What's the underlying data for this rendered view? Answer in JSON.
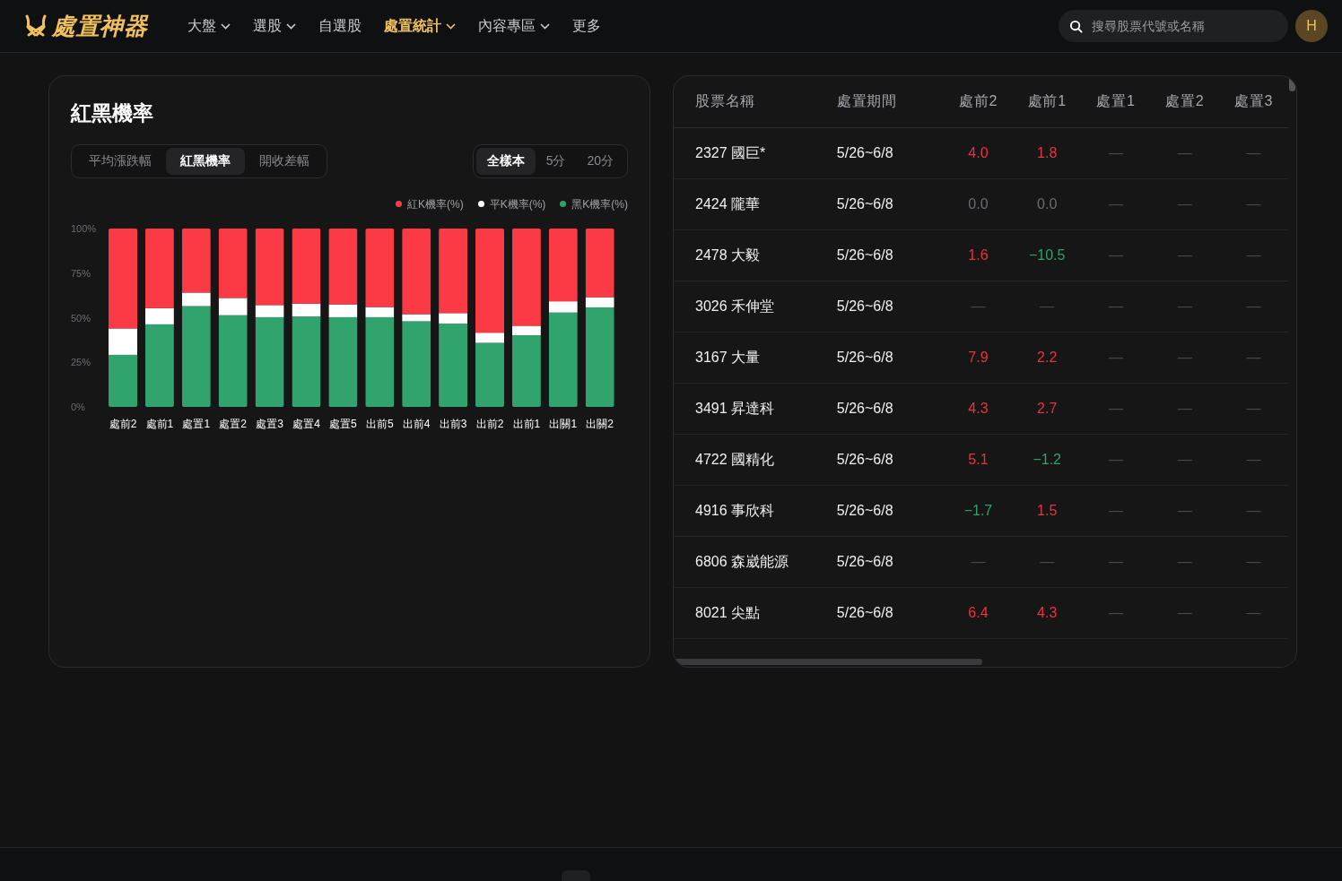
{
  "nav": {
    "logo": "處置神器",
    "items": [
      {
        "label": "大盤",
        "dropdown": true,
        "selected": false
      },
      {
        "label": "選股",
        "dropdown": true,
        "selected": false
      },
      {
        "label": "自選股",
        "dropdown": false,
        "selected": false
      },
      {
        "label": "處置統計",
        "dropdown": true,
        "selected": true
      },
      {
        "label": "內容專區",
        "dropdown": true,
        "selected": false
      },
      {
        "label": "更多",
        "dropdown": false,
        "selected": false
      }
    ],
    "search": {
      "placeholder": "搜尋股票代號或名稱"
    },
    "avatar": "H"
  },
  "chart_card": {
    "title": "紅黑機率",
    "metric_tabs": [
      {
        "label": "平均漲跌幅",
        "selected": false
      },
      {
        "label": "紅黑機率",
        "selected": true
      },
      {
        "label": "開收差幅",
        "selected": false
      }
    ],
    "sample_tabs": [
      {
        "label": "全樣本",
        "selected": true
      },
      {
        "label": "5分",
        "selected": false
      },
      {
        "label": "20分",
        "selected": false
      }
    ],
    "chart_data": {
      "type": "bar",
      "stacked": true,
      "categories": [
        "處前2",
        "處前1",
        "處置1",
        "處置2",
        "處置3",
        "處置4",
        "處置5",
        "出前5",
        "出前4",
        "出前3",
        "出前2",
        "出前1",
        "出關1",
        "出關2"
      ],
      "ylim": [
        0,
        100
      ],
      "yticks": [
        {
          "value": 0,
          "label": "0%"
        },
        {
          "value": 25,
          "label": "25%"
        },
        {
          "value": 50,
          "label": "50%"
        },
        {
          "value": 75,
          "label": "75%"
        },
        {
          "value": 100,
          "label": "100%"
        }
      ],
      "series": [
        {
          "name": "紅K機率(%)",
          "color": "#fc3a45",
          "values": [
            56,
            44.6,
            35.9,
            38.9,
            42.9,
            42.1,
            42.5,
            44,
            48,
            47.4,
            58.4,
            54.5,
            40.8,
            38.5
          ]
        },
        {
          "name": "平K機率(%)",
          "color": "#ffffff",
          "values": [
            14.8,
            9.1,
            7.6,
            9.7,
            6.8,
            7.2,
            7.2,
            5.7,
            4,
            5.9,
            5.7,
            5.3,
            6.3,
            5.7
          ]
        },
        {
          "name": "黑K機率(%)",
          "color": "#31a36d",
          "values": [
            29.2,
            46.3,
            56.5,
            51.4,
            50.3,
            50.7,
            50.3,
            50.3,
            48,
            46.7,
            35.9,
            40.2,
            52.9,
            55.8
          ]
        }
      ]
    }
  },
  "table": {
    "columns": [
      "股票名稱",
      "處置期間",
      "處前2",
      "處前1",
      "處置1",
      "處置2",
      "處置3"
    ],
    "rows": [
      {
        "cells": [
          {
            "text": "2327 國巨*",
            "color": "#f0f0f0"
          },
          {
            "text": "5/26~6/8",
            "color": "#f0f0f0"
          },
          {
            "text": "4.0",
            "color": "#e8333d"
          },
          {
            "text": "1.8",
            "color": "#e8333d"
          },
          {
            "text": "—",
            "color": "#4a4b4f"
          },
          {
            "text": "—",
            "color": "#4a4b4f"
          },
          {
            "text": "—",
            "color": "#4a4b4f"
          }
        ]
      },
      {
        "cells": [
          {
            "text": "2424 隴華",
            "color": "#f0f0f0"
          },
          {
            "text": "5/26~6/8",
            "color": "#f0f0f0"
          },
          {
            "text": "0.0",
            "color": "#6b6c70"
          },
          {
            "text": "0.0",
            "color": "#6b6c70"
          },
          {
            "text": "—",
            "color": "#4a4b4f"
          },
          {
            "text": "—",
            "color": "#4a4b4f"
          },
          {
            "text": "—",
            "color": "#4a4b4f"
          }
        ]
      },
      {
        "cells": [
          {
            "text": "2478 大毅",
            "color": "#f0f0f0"
          },
          {
            "text": "5/26~6/8",
            "color": "#f0f0f0"
          },
          {
            "text": "1.6",
            "color": "#e8333d"
          },
          {
            "text": "−10.5",
            "color": "#2ea36a"
          },
          {
            "text": "—",
            "color": "#4a4b4f"
          },
          {
            "text": "—",
            "color": "#4a4b4f"
          },
          {
            "text": "—",
            "color": "#4a4b4f"
          }
        ]
      },
      {
        "cells": [
          {
            "text": "3026 禾伸堂",
            "color": "#f0f0f0"
          },
          {
            "text": "5/26~6/8",
            "color": "#f0f0f0"
          },
          {
            "text": "—",
            "color": "#4a4b4f"
          },
          {
            "text": "—",
            "color": "#4a4b4f"
          },
          {
            "text": "—",
            "color": "#4a4b4f"
          },
          {
            "text": "—",
            "color": "#4a4b4f"
          },
          {
            "text": "—",
            "color": "#4a4b4f"
          }
        ]
      },
      {
        "cells": [
          {
            "text": "3167 大量",
            "color": "#f0f0f0"
          },
          {
            "text": "5/26~6/8",
            "color": "#f0f0f0"
          },
          {
            "text": "7.9",
            "color": "#e8333d"
          },
          {
            "text": "2.2",
            "color": "#e8333d"
          },
          {
            "text": "—",
            "color": "#4a4b4f"
          },
          {
            "text": "—",
            "color": "#4a4b4f"
          },
          {
            "text": "—",
            "color": "#4a4b4f"
          }
        ]
      },
      {
        "cells": [
          {
            "text": "3491 昇達科",
            "color": "#f0f0f0"
          },
          {
            "text": "5/26~6/8",
            "color": "#f0f0f0"
          },
          {
            "text": "4.3",
            "color": "#e8333d"
          },
          {
            "text": "2.7",
            "color": "#e8333d"
          },
          {
            "text": "—",
            "color": "#4a4b4f"
          },
          {
            "text": "—",
            "color": "#4a4b4f"
          },
          {
            "text": "—",
            "color": "#4a4b4f"
          }
        ]
      },
      {
        "cells": [
          {
            "text": "4722 國精化",
            "color": "#f0f0f0"
          },
          {
            "text": "5/26~6/8",
            "color": "#f0f0f0"
          },
          {
            "text": "5.1",
            "color": "#e8333d"
          },
          {
            "text": "−1.2",
            "color": "#2ea36a"
          },
          {
            "text": "—",
            "color": "#4a4b4f"
          },
          {
            "text": "—",
            "color": "#4a4b4f"
          },
          {
            "text": "—",
            "color": "#4a4b4f"
          }
        ]
      },
      {
        "cells": [
          {
            "text": "4916 事欣科",
            "color": "#f0f0f0"
          },
          {
            "text": "5/26~6/8",
            "color": "#f0f0f0"
          },
          {
            "text": "−1.7",
            "color": "#2ea36a"
          },
          {
            "text": "1.5",
            "color": "#e8333d"
          },
          {
            "text": "—",
            "color": "#4a4b4f"
          },
          {
            "text": "—",
            "color": "#4a4b4f"
          },
          {
            "text": "—",
            "color": "#4a4b4f"
          }
        ]
      },
      {
        "cells": [
          {
            "text": "6806 森崴能源",
            "color": "#f0f0f0"
          },
          {
            "text": "5/26~6/8",
            "color": "#f0f0f0"
          },
          {
            "text": "—",
            "color": "#4a4b4f"
          },
          {
            "text": "—",
            "color": "#4a4b4f"
          },
          {
            "text": "—",
            "color": "#4a4b4f"
          },
          {
            "text": "—",
            "color": "#4a4b4f"
          },
          {
            "text": "—",
            "color": "#4a4b4f"
          }
        ]
      },
      {
        "cells": [
          {
            "text": "8021 尖點",
            "color": "#f0f0f0"
          },
          {
            "text": "5/26~6/8",
            "color": "#f0f0f0"
          },
          {
            "text": "6.4",
            "color": "#e8333d"
          },
          {
            "text": "4.3",
            "color": "#e8333d"
          },
          {
            "text": "—",
            "color": "#4a4b4f"
          },
          {
            "text": "—",
            "color": "#4a4b4f"
          },
          {
            "text": "—",
            "color": "#4a4b4f"
          }
        ]
      }
    ]
  }
}
